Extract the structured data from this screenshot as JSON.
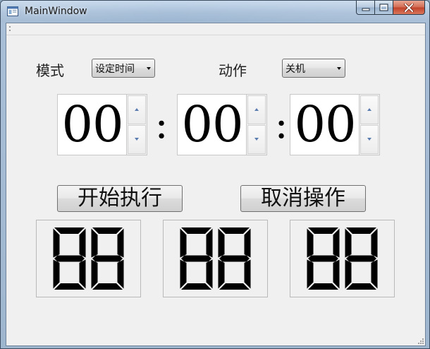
{
  "window": {
    "title": "MainWindow",
    "icons": {
      "app": "app-window-icon",
      "minimize": "minimize-icon",
      "maximize": "maximize-icon",
      "close": "close-icon"
    }
  },
  "mode": {
    "label": "模式",
    "selected": "设定时间"
  },
  "action": {
    "label": "动作",
    "selected": "关机"
  },
  "time": {
    "hours": "00",
    "minutes": "00",
    "seconds": "00",
    "separator": ":"
  },
  "buttons": {
    "start": "开始执行",
    "cancel": "取消操作"
  },
  "lcd": {
    "hours": "88",
    "minutes": "88",
    "seconds": "88"
  },
  "colors": {
    "lcd_segment": "#000000",
    "spin_arrow": "#5a7cb0",
    "client_bg": "#f0f0f0"
  }
}
